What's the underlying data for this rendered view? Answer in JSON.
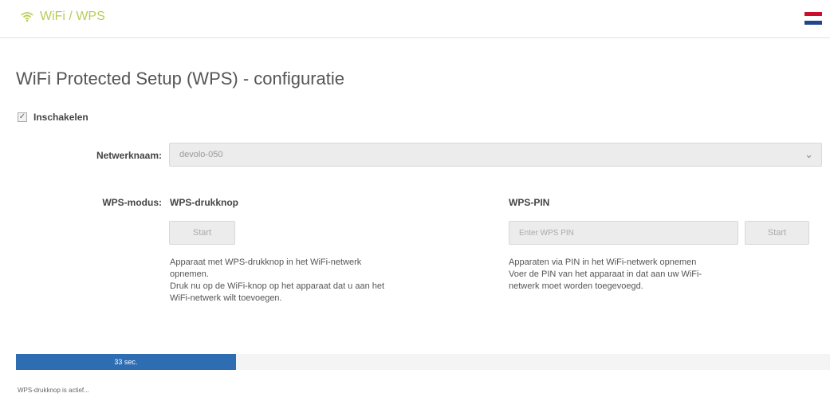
{
  "header": {
    "breadcrumb": "WiFi / WPS",
    "wifi_icon": "wifi-icon",
    "flag_icon": "flag-nl-icon",
    "flag_colors": [
      "#c8102e",
      "#ffffff",
      "#21468b"
    ],
    "accent_color": "#b6cf55"
  },
  "page": {
    "title": "WiFi Protected Setup (WPS) - configuratie"
  },
  "enable": {
    "label": "Inschakelen",
    "checked": true
  },
  "network": {
    "label": "Netwerknaam:",
    "value": "devolo-050"
  },
  "wps_mode": {
    "label": "WPS-modus:",
    "pushbutton": {
      "heading": "WPS-drukknop",
      "button_label": "Start",
      "description_lines": [
        "Apparaat met WPS-drukknop in het WiFi-netwerk",
        "opnemen.",
        "Druk nu op de WiFi-knop op het apparaat dat u aan het",
        "WiFi-netwerk wilt toevoegen."
      ]
    },
    "pin": {
      "heading": "WPS-PIN",
      "placeholder": "Enter WPS PIN",
      "button_label": "Start",
      "description_lines": [
        "Apparaten via PIN in het WiFi-netwerk opnemen",
        "Voer de PIN van het apparaat in dat aan uw WiFi-",
        "netwerk moet worden toegevoegd."
      ]
    }
  },
  "progress": {
    "label": "33 sec.",
    "fraction": 0.27,
    "color": "#2f6db3"
  },
  "status": "WPS-drukknop is actief..."
}
